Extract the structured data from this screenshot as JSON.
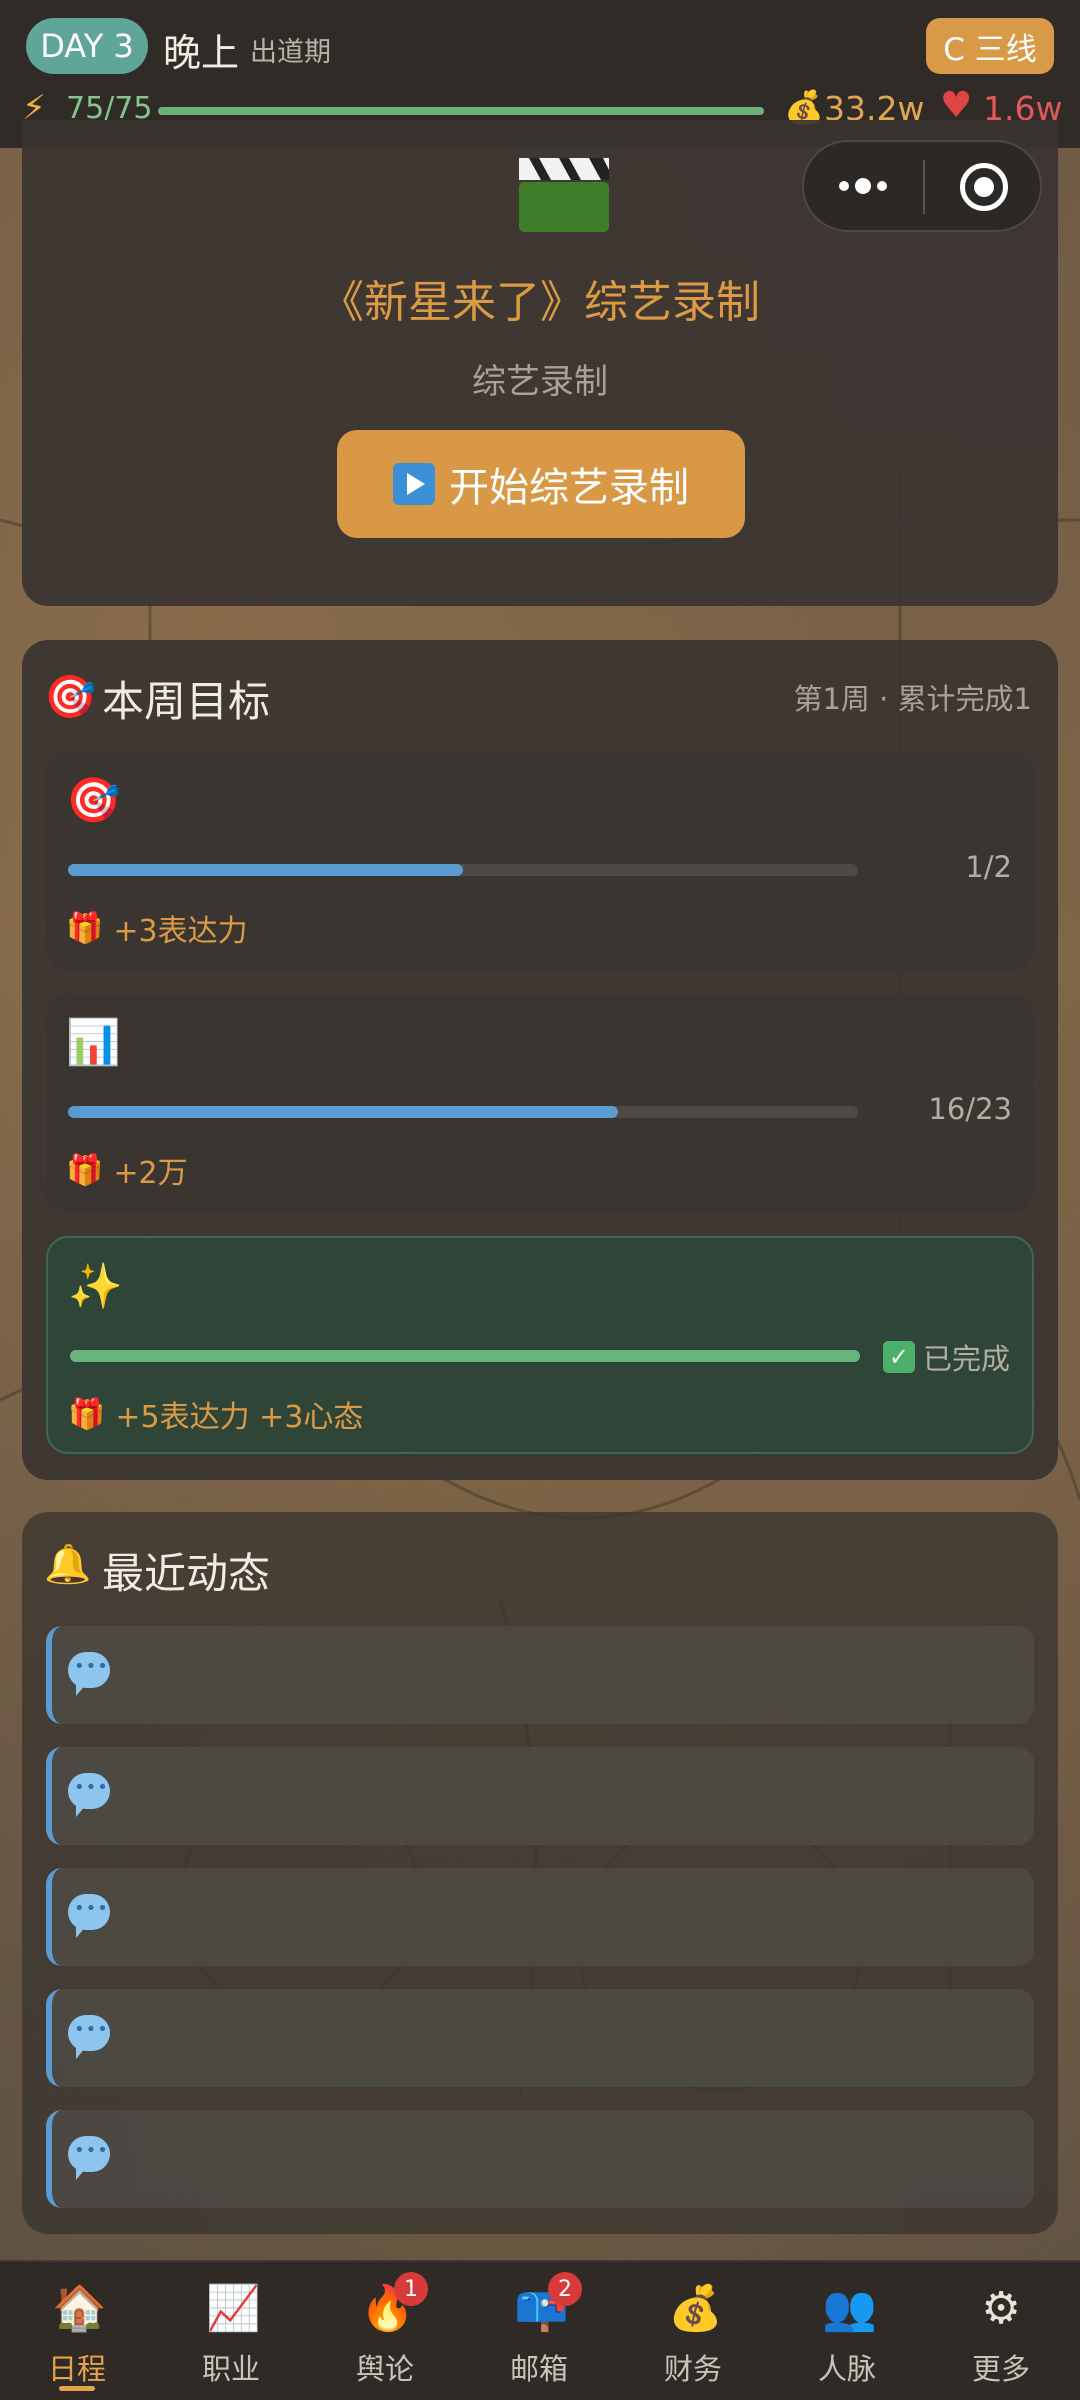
{
  "header": {
    "day_badge": "DAY 3",
    "time_of_day": "晚上",
    "phase": "出道期",
    "tier_badge": "C 三线",
    "energy": "75/75",
    "energy_fraction": 1.0,
    "money": "33.2w",
    "fans": "1.6w"
  },
  "event": {
    "title": "《新星来了》综艺录制",
    "subtitle": "综艺录制",
    "button_label": "开始综艺录制",
    "icon": "clapperboard-icon"
  },
  "weekly_goals": {
    "title": "本周目标",
    "meta": "第1周 · 累计完成1",
    "goals": [
      {
        "icon": "target-icon",
        "progress_text": "1/2",
        "progress": 0.5,
        "reward": "+3表达力",
        "done": false
      },
      {
        "icon": "bar-chart-icon",
        "progress_text": "16/23",
        "progress": 0.6957,
        "reward": "+2万",
        "done": false
      },
      {
        "icon": "sparkles-icon",
        "progress_text": "已完成",
        "progress": 1.0,
        "reward": "+5表达力 +3心态",
        "done": true
      }
    ]
  },
  "recent_news": {
    "title": "最近动态",
    "items": [
      "",
      "",
      "",
      "",
      ""
    ]
  },
  "tabbar": {
    "tabs": [
      {
        "label": "日程",
        "icon": "house-icon",
        "active": true,
        "badge": ""
      },
      {
        "label": "职业",
        "icon": "trend-chart-icon",
        "active": false,
        "badge": ""
      },
      {
        "label": "舆论",
        "icon": "fire-icon",
        "active": false,
        "badge": "1"
      },
      {
        "label": "邮箱",
        "icon": "mailbox-icon",
        "active": false,
        "badge": "2"
      },
      {
        "label": "财务",
        "icon": "money-bag-icon",
        "active": false,
        "badge": ""
      },
      {
        "label": "人脉",
        "icon": "people-icon",
        "active": false,
        "badge": ""
      },
      {
        "label": "更多",
        "icon": "gear-icon",
        "active": false,
        "badge": ""
      }
    ]
  },
  "colors": {
    "accent": "#d89845",
    "teal": "#5fa59a",
    "progress_blue": "#5b9bd0",
    "progress_green": "#69b47a"
  }
}
